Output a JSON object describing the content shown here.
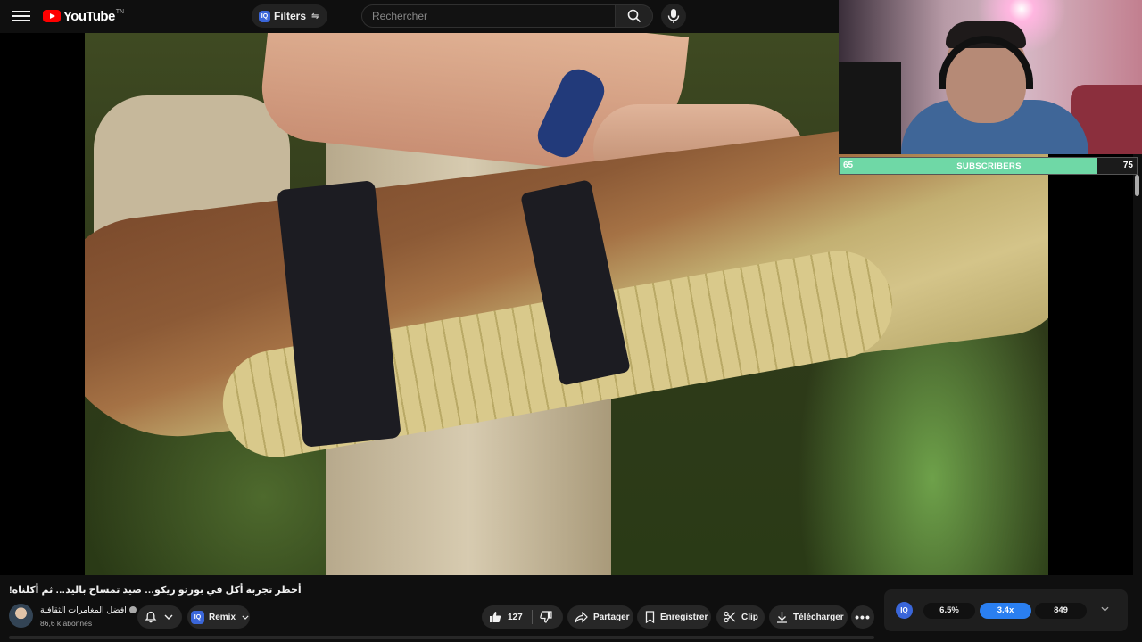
{
  "header": {
    "logo_text": "YouTube",
    "logo_sup": "TN",
    "filters_label": "Filters",
    "filters_badge": "IQ",
    "search_placeholder": "Rechercher"
  },
  "webcam_overlay": {
    "subscriber_goal": {
      "current": "65",
      "label": "SUBSCRIBERS",
      "target": "75",
      "progress_fraction": 0.867,
      "fill_color": "#6fd8a6"
    }
  },
  "video": {
    "title": "أخطر تجربة أكل في بورتو ريكو… صيد تمساح باليد… ثم أكلناه!",
    "channel_name": "افضل المغامرات الثقافية",
    "subscribers": "86,6 k abonnés"
  },
  "actions": {
    "remix_badge": "IQ",
    "remix_label": "Remix",
    "like_count": "127",
    "share_label": "Partager",
    "save_label": "Enregistrer",
    "clip_label": "Clip",
    "download_label": "Télécharger",
    "more_label": "•••"
  },
  "iq_panel": {
    "badge": "IQ",
    "stats": [
      "6.5%",
      "3.4x",
      "849"
    ],
    "highlight_color": "#2a7ff1"
  },
  "colors": {
    "background": "#0f0f0f",
    "brand_red": "#ff0000",
    "iq_blue": "#3a66d9"
  }
}
